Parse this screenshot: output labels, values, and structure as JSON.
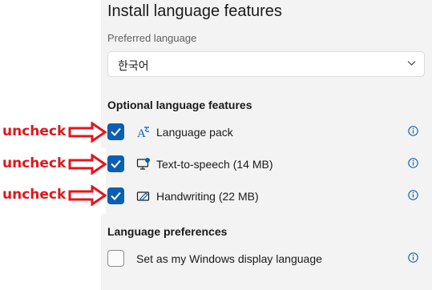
{
  "dialog": {
    "title": "Install language features",
    "preferred_language_label": "Preferred language",
    "preferred_language_value": "한국어"
  },
  "optional_features": {
    "heading": "Optional language features",
    "items": [
      {
        "label": "Language pack",
        "checked": true,
        "icon": "language-pack-icon"
      },
      {
        "label": "Text-to-speech (14 MB)",
        "checked": true,
        "icon": "text-to-speech-icon"
      },
      {
        "label": "Handwriting (22 MB)",
        "checked": true,
        "icon": "handwriting-icon"
      }
    ]
  },
  "preferences": {
    "heading": "Language preferences",
    "items": [
      {
        "label": "Set as my Windows display language",
        "checked": false
      }
    ]
  },
  "annotations": {
    "label": "uncheck",
    "color": "#e3161c"
  },
  "colors": {
    "accent": "#0a5fb4",
    "panel_bg": "#f3f3f3"
  }
}
